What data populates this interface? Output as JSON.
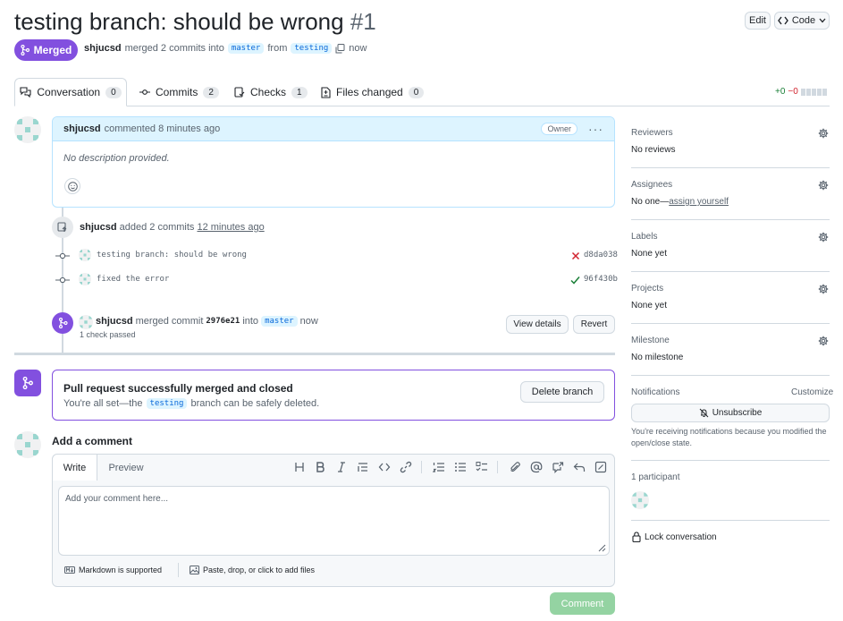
{
  "pr": {
    "title": "testing branch: should be wrong",
    "number": "#1",
    "status": "Merged",
    "author": "shjucsd",
    "merge_text": "merged 2 commits into",
    "base_branch": "master",
    "from_text": "from",
    "head_branch": "testing",
    "time": "now",
    "edit_label": "Edit",
    "code_label": "Code"
  },
  "tabs": [
    {
      "label": "Conversation",
      "count": "0"
    },
    {
      "label": "Commits",
      "count": "2"
    },
    {
      "label": "Checks",
      "count": "1"
    },
    {
      "label": "Files changed",
      "count": "0"
    }
  ],
  "diffstat": {
    "added": "+0",
    "removed": "−0"
  },
  "comment": {
    "author": "shjucsd",
    "action": "commented 8 minutes ago",
    "badge": "Owner",
    "body": "No description provided."
  },
  "commits_event": {
    "author": "shjucsd",
    "action": "added 2 commits",
    "time": "12 minutes ago",
    "commits": [
      {
        "message": "testing branch: should be wrong",
        "sha": "d8da038",
        "status": "fail"
      },
      {
        "message": "fixed the error",
        "sha": "96f430b",
        "status": "pass"
      }
    ]
  },
  "merge_event": {
    "author": "shjucsd",
    "action": "merged commit",
    "sha": "2976e21",
    "into": "into",
    "branch": "master",
    "time": "now",
    "checks": "1 check passed",
    "view_details": "View details",
    "revert": "Revert"
  },
  "merged_box": {
    "title": "Pull request successfully merged and closed",
    "text_before": "You're all set—the",
    "branch": "testing",
    "text_after": "branch can be safely deleted.",
    "delete_label": "Delete branch"
  },
  "add_comment": {
    "heading": "Add a comment",
    "tab_write": "Write",
    "tab_preview": "Preview",
    "placeholder": "Add your comment here...",
    "markdown_note": "Markdown is supported",
    "attach_note": "Paste, drop, or click to add files",
    "submit": "Comment"
  },
  "sidebar": {
    "reviewers": {
      "label": "Reviewers",
      "value": "No reviews"
    },
    "assignees": {
      "label": "Assignees",
      "value": "No one—",
      "link": "assign yourself"
    },
    "labels": {
      "label": "Labels",
      "value": "None yet"
    },
    "projects": {
      "label": "Projects",
      "value": "None yet"
    },
    "milestone": {
      "label": "Milestone",
      "value": "No milestone"
    },
    "notifications": {
      "label": "Notifications",
      "customize": "Customize",
      "button": "Unsubscribe",
      "note": "You're receiving notifications because you modified the open/close state."
    },
    "participants": {
      "label": "1 participant"
    },
    "lock": "Lock conversation"
  },
  "colors": {
    "merged": "#8250df",
    "link": "#0969da",
    "success": "#1a7f37",
    "danger": "#d1242f",
    "comment_header": "#ddf4ff",
    "comment_border": "#b6e3ff",
    "submit_disabled": "#94d3a2"
  }
}
